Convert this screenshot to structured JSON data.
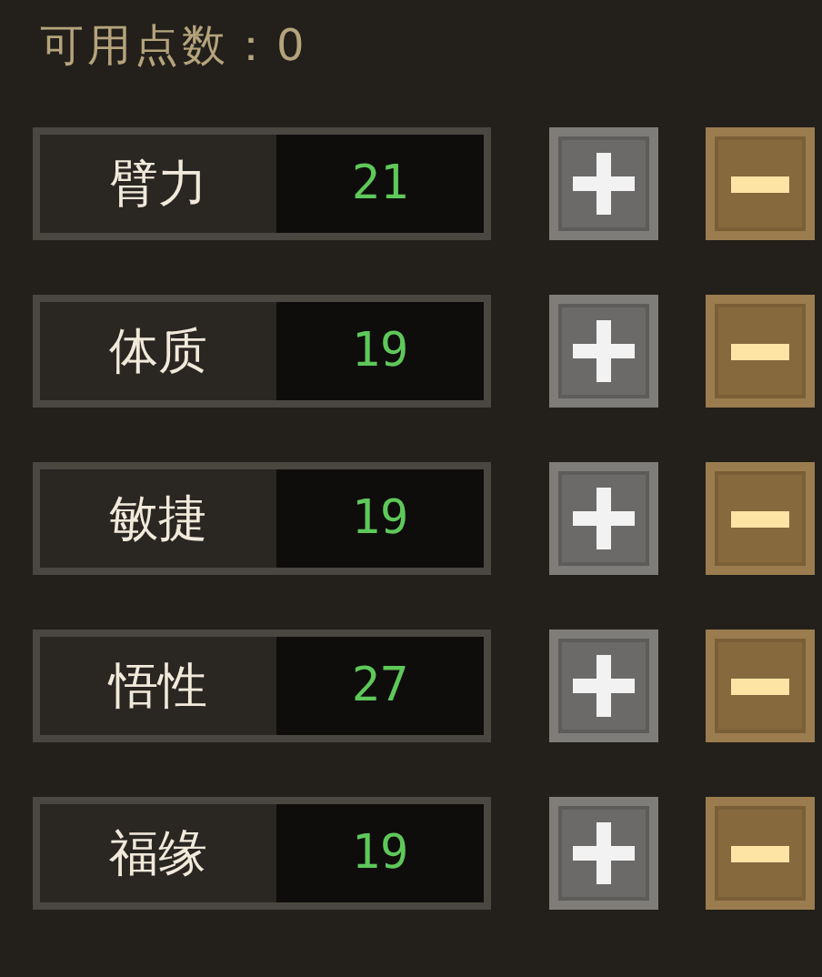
{
  "points_label": "可用点数：0",
  "stats": [
    {
      "name": "臂力",
      "value": "21"
    },
    {
      "name": "体质",
      "value": "19"
    },
    {
      "name": "敏捷",
      "value": "19"
    },
    {
      "name": "悟性",
      "value": "27"
    },
    {
      "name": "福缘",
      "value": "19"
    }
  ]
}
